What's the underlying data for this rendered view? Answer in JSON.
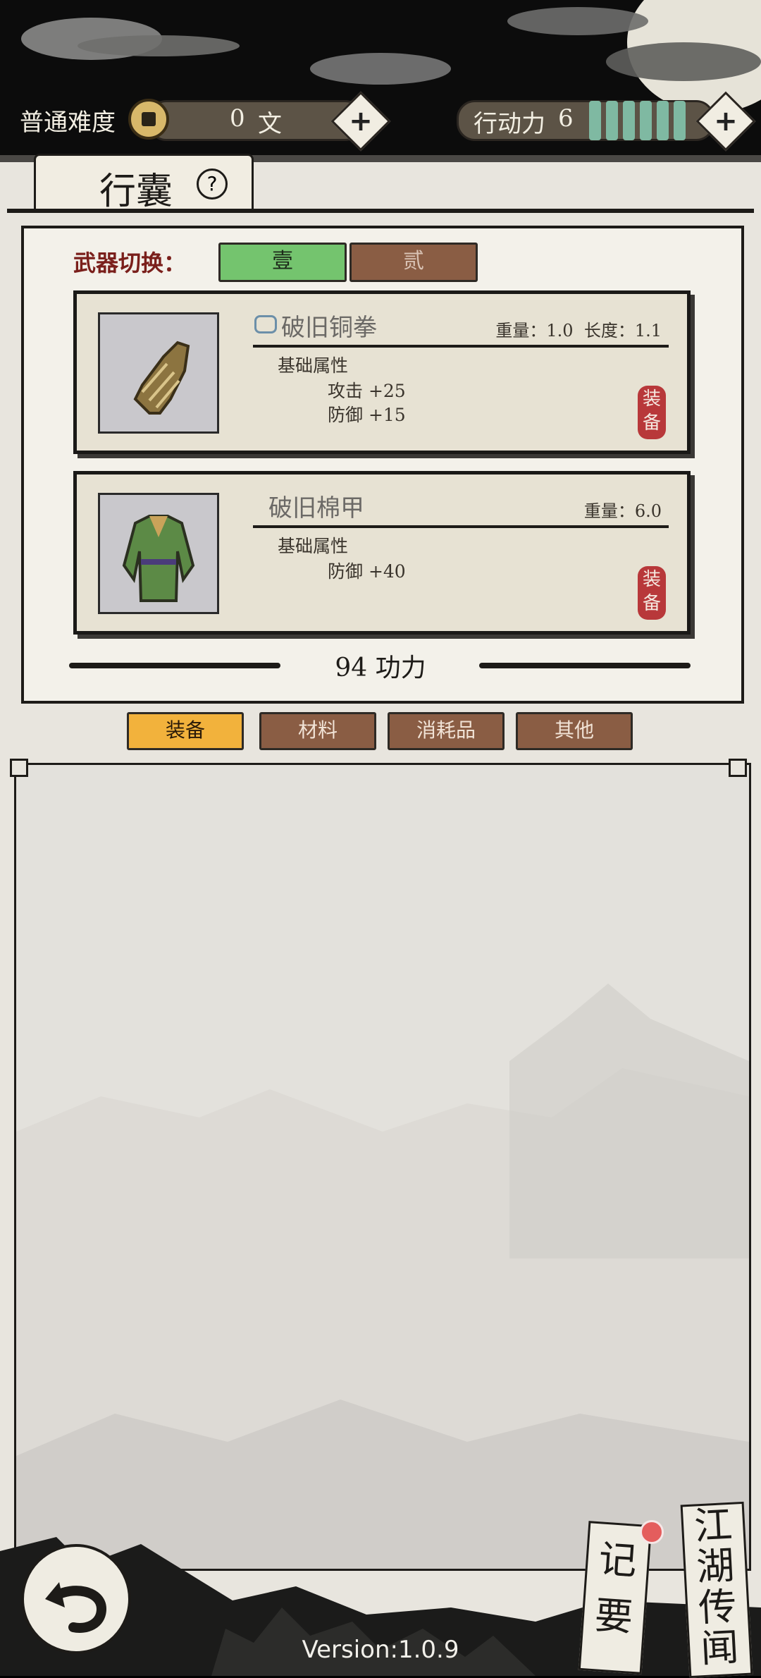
{
  "header": {
    "difficulty": "普通难度",
    "currency_value": "0",
    "currency_unit": "文",
    "action_label": "行动力",
    "action_value": "6",
    "plus_symbol": "+"
  },
  "panel": {
    "title": "行囊",
    "help_symbol": "?",
    "weapon_switch_label": "武器切换：",
    "weapon_sets": [
      "壹",
      "贰"
    ],
    "active_weapon_set": "壹"
  },
  "equipped_items": [
    {
      "name": "破旧铜拳",
      "stats_right": "重量：1.0  长度：1.1",
      "section_label": "基础属性",
      "attrs": [
        "攻击 +25",
        "防御 +15"
      ],
      "stamp": "装备",
      "icon": "bronze-fist-icon"
    },
    {
      "name": "破旧棉甲",
      "stats_right": "重量：6.0",
      "section_label": "基础属性",
      "attrs": [
        "防御 +40"
      ],
      "stamp": "装备",
      "icon": "cotton-armor-icon"
    }
  ],
  "power_label": "94 功力",
  "categories": [
    "装备",
    "材料",
    "消耗品",
    "其他"
  ],
  "active_category": "装备",
  "side_cards": {
    "notes": "记要",
    "rumors": "江湖传闻"
  },
  "version": "Version:1.0.9",
  "colors": {
    "active_tab": "#f2b23c",
    "inactive_tab": "#8a5d44",
    "weapon_active": "#74c46e",
    "stamp_red": "#b8383a",
    "action_green": "#7fb9a2"
  }
}
